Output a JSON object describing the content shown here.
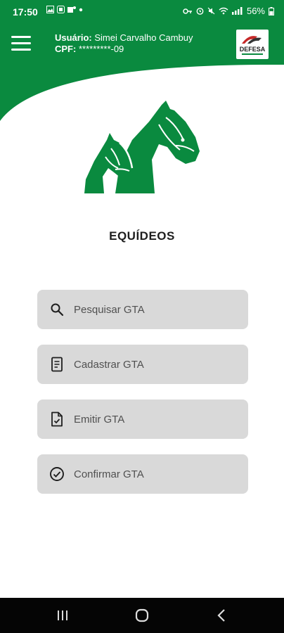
{
  "status_bar": {
    "time": "17:50",
    "battery": "56%"
  },
  "header": {
    "user_label": "Usuário:",
    "user_name": "Simei Carvalho Cambuy",
    "cpf_label": "CPF:",
    "cpf_value": "*********-09",
    "logo_text": "DEFESA"
  },
  "page": {
    "title": "EQUÍDEOS"
  },
  "menu_items": [
    {
      "label": "Pesquisar GTA",
      "icon": "search-icon"
    },
    {
      "label": "Cadastrar GTA",
      "icon": "document-icon"
    },
    {
      "label": "Emitir GTA",
      "icon": "file-check-icon"
    },
    {
      "label": "Confirmar GTA",
      "icon": "check-circle-icon"
    }
  ],
  "colors": {
    "brand_green": "#0a8a3f",
    "button_gray": "#d9d9d9"
  }
}
